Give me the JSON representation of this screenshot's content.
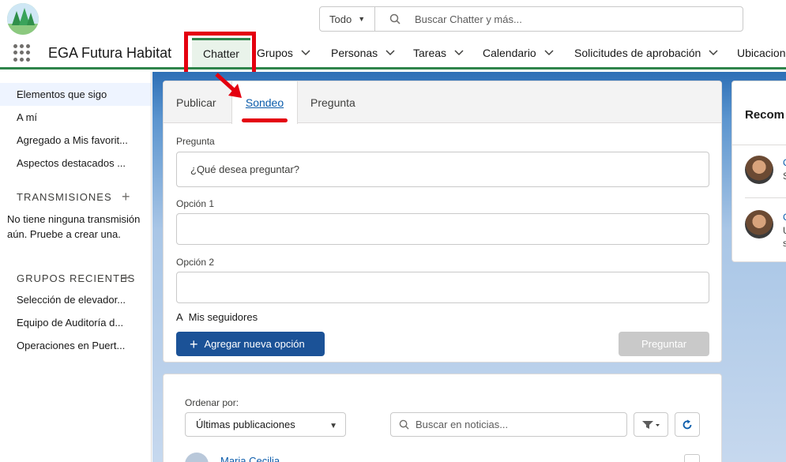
{
  "header": {
    "search_scope": "Todo",
    "search_placeholder": "Buscar Chatter y más..."
  },
  "nav": {
    "app_name": "EGA Futura Habitat",
    "items": [
      {
        "label": "Chatter"
      },
      {
        "label": "Grupos"
      },
      {
        "label": "Personas"
      },
      {
        "label": "Tareas"
      },
      {
        "label": "Calendario"
      },
      {
        "label": "Solicitudes de aprobación"
      },
      {
        "label": "Ubicacione"
      }
    ]
  },
  "sidebar": {
    "items": [
      {
        "label": "Elementos que sigo"
      },
      {
        "label": "A mí"
      },
      {
        "label": "Agregado a Mis favorit..."
      },
      {
        "label": "Aspectos destacados ..."
      }
    ],
    "streams_heading": "TRANSMISIONES",
    "streams_note": "No tiene ninguna transmisión aún. Pruebe a crear una.",
    "groups_heading": "GRUPOS RECIENTES",
    "groups": [
      {
        "label": "Selección de elevador..."
      },
      {
        "label": "Equipo de Auditoría d..."
      },
      {
        "label": "Operaciones en Puert..."
      }
    ]
  },
  "publisher": {
    "tabs": [
      {
        "label": "Publicar"
      },
      {
        "label": "Sondeo"
      },
      {
        "label": "Pregunta"
      }
    ],
    "question_label": "Pregunta",
    "question_placeholder": "¿Qué desea preguntar?",
    "option1_label": "Opción 1",
    "option2_label": "Opción 2",
    "audience_icon": "A",
    "audience_label": "Mis seguidores",
    "add_option_label": "Agregar nueva opción",
    "ask_label": "Preguntar"
  },
  "feed": {
    "sort_label": "Ordenar por:",
    "sort_value": "Últimas publicaciones",
    "search_placeholder": "Buscar en noticias...",
    "first_author": "Maria Cecilia"
  },
  "recommendations": {
    "title": "Recom",
    "items": [
      {
        "initial": "C",
        "sub": "S"
      },
      {
        "initial": "C",
        "sub": "U",
        "sub2": "s"
      }
    ]
  },
  "colors": {
    "accent_green": "#2e844a",
    "brand_blue": "#1b5297",
    "annotation_red": "#e4000f"
  }
}
